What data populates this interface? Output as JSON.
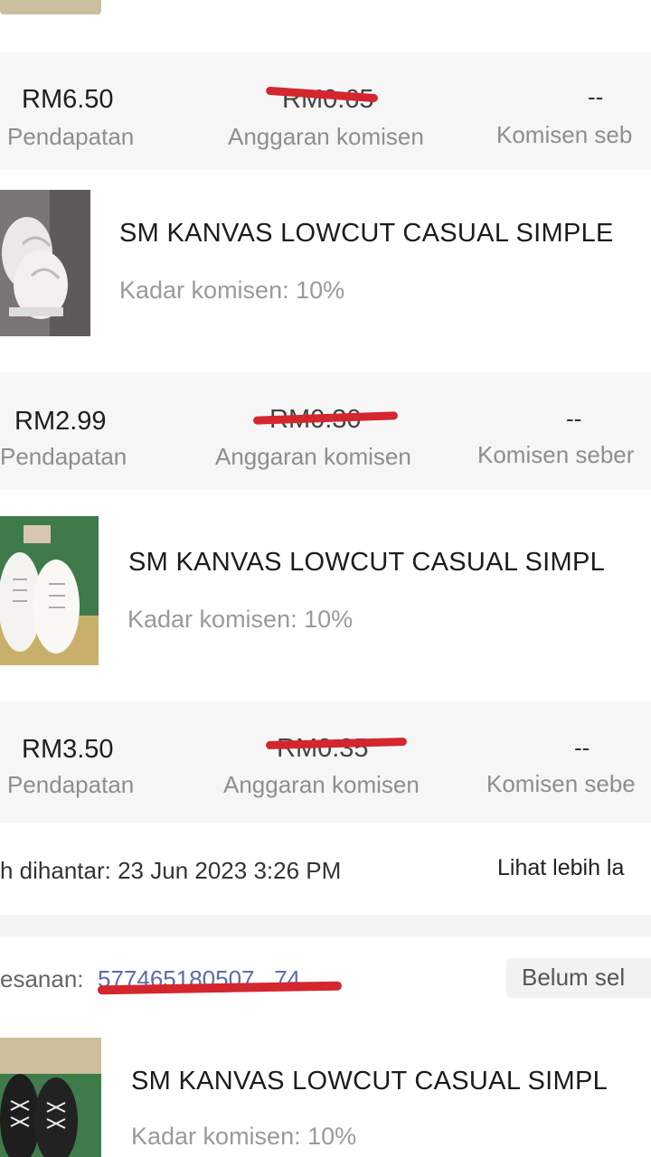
{
  "colors": {
    "accent_red": "#d4262f",
    "muted_text": "#8e8e8e",
    "band_bg": "#f6f6f6"
  },
  "earnings_rows": [
    {
      "pendapatan_value": "RM6.50",
      "pendapatan_label": "Pendapatan",
      "anggaran_value": "RM0.65",
      "anggaran_label": "Anggaran komisen",
      "sebenar_value": "--",
      "sebenar_label": "Komisen seb"
    },
    {
      "pendapatan_value": "RM2.99",
      "pendapatan_label": "Pendapatan",
      "anggaran_value": "RM0.30",
      "anggaran_label": "Anggaran komisen",
      "sebenar_value": "--",
      "sebenar_label": "Komisen seber"
    },
    {
      "pendapatan_value": "RM3.50",
      "pendapatan_label": "Pendapatan",
      "anggaran_value": "RM0.35",
      "anggaran_label": "Anggaran komisen",
      "sebenar_value": "--",
      "sebenar_label": "Komisen sebe"
    }
  ],
  "products": [
    {
      "name": "SM KANVAS LOWCUT CASUAL SIMPLE",
      "rate": "Kadar komisen: 10%",
      "icon": "white-sneaker-photo"
    },
    {
      "name": "SM KANVAS LOWCUT CASUAL SIMPL",
      "rate": "Kadar komisen: 10%",
      "icon": "white-sneaker-photo"
    },
    {
      "name": "SM KANVAS LOWCUT CASUAL SIMPL",
      "rate": "Kadar komisen: 10%",
      "icon": "black-sneaker-photo"
    }
  ],
  "order": {
    "sent_text": "h dihantar: 23 Jun 2023 3:26 PM",
    "see_more": "Lihat lebih la",
    "order_label": "esanan:",
    "order_number": "577465180507...74",
    "status": "Belum sel"
  }
}
